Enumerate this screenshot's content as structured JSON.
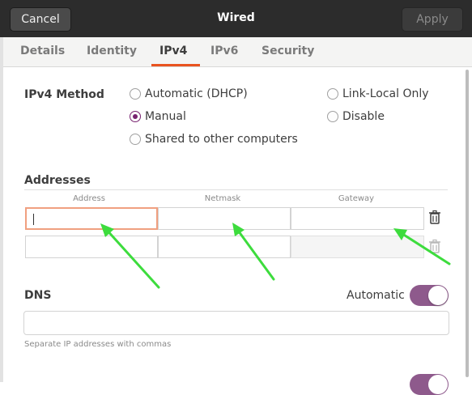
{
  "titlebar": {
    "cancel": "Cancel",
    "title": "Wired",
    "apply": "Apply"
  },
  "tabs": [
    {
      "label": "Details"
    },
    {
      "label": "Identity"
    },
    {
      "label": "IPv4"
    },
    {
      "label": "IPv6"
    },
    {
      "label": "Security"
    }
  ],
  "active_tab": "IPv4",
  "ipv4": {
    "method_label": "IPv4 Method",
    "options": {
      "dhcp": "Automatic (DHCP)",
      "link_local": "Link-Local Only",
      "manual": "Manual",
      "disable": "Disable",
      "shared": "Shared to other computers"
    },
    "selected": "Manual"
  },
  "addresses": {
    "label": "Addresses",
    "columns": [
      "Address",
      "Netmask",
      "Gateway"
    ],
    "rows": [
      {
        "address": "",
        "netmask": "",
        "gateway": ""
      },
      {
        "address": "",
        "netmask": "",
        "gateway": ""
      }
    ]
  },
  "dns": {
    "label": "DNS",
    "automatic_label": "Automatic",
    "automatic_on": true,
    "value": "",
    "hint": "Separate IP addresses with commas"
  },
  "colors": {
    "accent": "#e95420",
    "toggle": "#8e5a8c",
    "radio": "#77216f",
    "annotation_arrow": "#3ddc3d"
  }
}
